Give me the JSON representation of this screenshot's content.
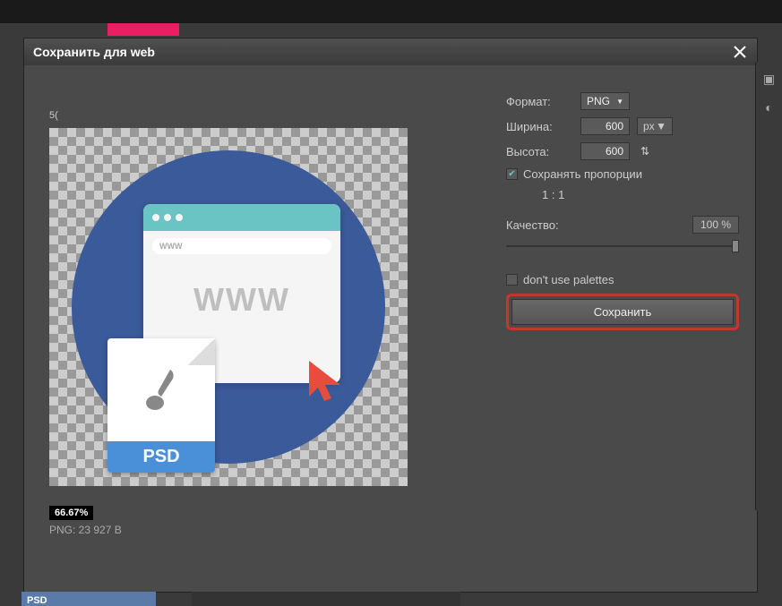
{
  "dialog": {
    "title": "Сохранить для web",
    "preview_corner_label": "5(",
    "zoom_percent": "66.67%",
    "file_info": "PNG: 23 927 B"
  },
  "preview_art": {
    "addr_text": "WWW",
    "www_big": "WWW",
    "psd_label": "PSD"
  },
  "settings": {
    "format_label": "Формат:",
    "format_value": "PNG",
    "width_label": "Ширина:",
    "width_value": "600",
    "width_unit": "px",
    "height_label": "Высота:",
    "height_value": "600",
    "keep_prop_label": "Сохранять пропорции",
    "ratio_text": "1 : 1",
    "quality_label": "Качество:",
    "quality_value": "100 %",
    "palettes_label": "don't use palettes",
    "save_button": "Сохранить"
  },
  "strip_label": "PSD"
}
